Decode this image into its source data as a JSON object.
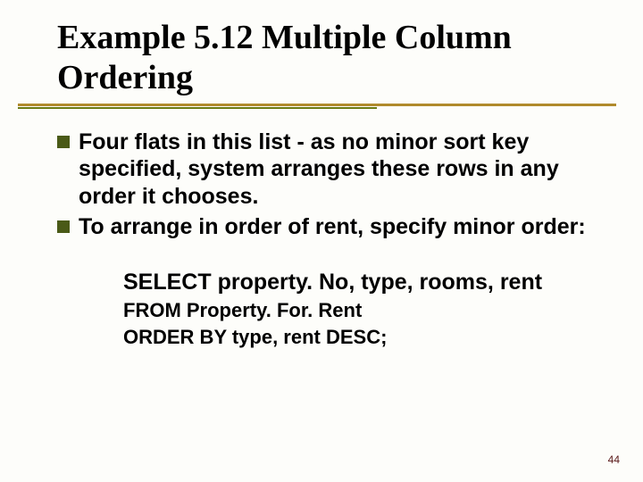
{
  "title": "Example 5.12  Multiple Column Ordering",
  "bullets": [
    "Four flats in this list - as no minor sort key specified, system arranges these rows in any order it chooses.",
    "To arrange in order of rent, specify minor order:"
  ],
  "code": {
    "line1": "SELECT property. No, type, rooms, rent",
    "line2": "FROM Property. For. Rent",
    "line3": "ORDER BY type, rent DESC;"
  },
  "page_number": "44"
}
